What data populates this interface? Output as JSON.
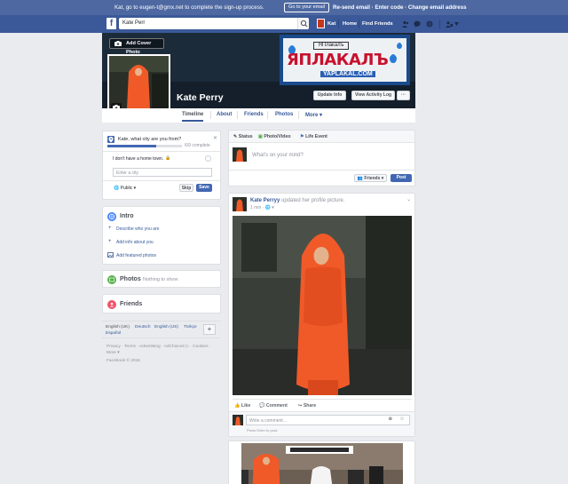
{
  "banner": {
    "message": "Kat, go to eugen-t@gmx.net to complete the sign-up process.",
    "button_label": "Go to your email",
    "links_text": "Re-send email · Enter code · Change email address"
  },
  "nav": {
    "logo": "f",
    "search_value": "Kate Perr",
    "user_name": "Kat",
    "home_label": "Home",
    "find_friends_label": "Find Friends"
  },
  "cover": {
    "add_cover_label": "Add Cover Photo",
    "ad_top_text": "ЯПлакалъ",
    "ad_main_text": "ЯПЛАКАЛЪ",
    "ad_url": "YAPLAKAL.COM",
    "profile_name": "Kate Perry",
    "update_info_label": "Update Info",
    "activity_log_label": "View Activity Log",
    "more_dots": "···"
  },
  "tabs": [
    "Timeline",
    "About",
    "Friends",
    "Photos",
    "More"
  ],
  "hometown": {
    "question": "Kate, what city are you from?",
    "progress_text": "6/9 complete",
    "progress": 0.66,
    "no_hometown": "I don't have a home town.",
    "city_placeholder": "Enter a city",
    "privacy": "Public",
    "skip_label": "Skip",
    "save_label": "Save"
  },
  "intro": {
    "title": "Intro",
    "items": [
      "Describe who you are",
      "Add info about you",
      "Add featured photos"
    ]
  },
  "photos_box": {
    "title": "Photos",
    "subtitle": "Nothing to show"
  },
  "friends_box": {
    "title": "Friends"
  },
  "languages": {
    "current": "English (UK)",
    "others": [
      "Deutsch",
      "English (US)",
      "Türkçe",
      "Español"
    ]
  },
  "footer": {
    "line1": "Privacy · Terms · Advertising · AdChoices ▷ · Cookies ·",
    "line2": "More ▾",
    "copyright": "Facebook © 2016"
  },
  "composer": {
    "status_label": "Status",
    "photo_video_label": "Photo/Video",
    "life_event_label": "Life Event",
    "placeholder": "What's on your mind?",
    "audience_label": "Friends",
    "post_label": "Post"
  },
  "post": {
    "author": "Kate Perryy",
    "action": "updated her profile picture.",
    "time": "1 min",
    "like_label": "Like",
    "comment_label": "Comment",
    "share_label": "Share",
    "comment_placeholder": "Write a comment...",
    "enter_hint": "Press Enter to post."
  },
  "colors": {
    "fb_blue": "#3b5998",
    "banner_blue": "#4e69a2",
    "link_blue": "#365899",
    "background": "#e9ebee",
    "costume_orange": "#f05a28"
  }
}
